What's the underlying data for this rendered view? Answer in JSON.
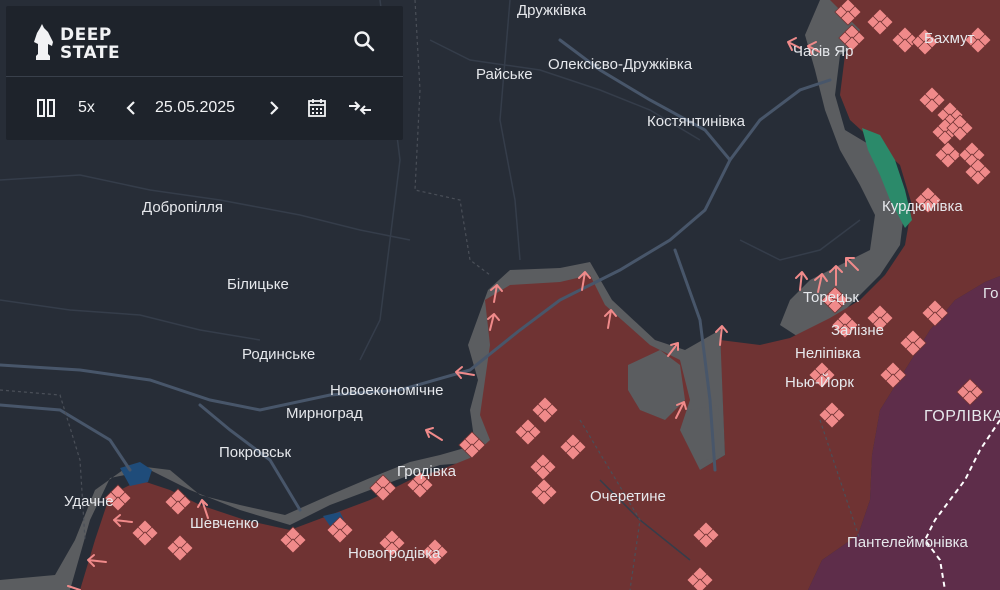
{
  "logo": {
    "line1": "DEEP",
    "line2": "STATE"
  },
  "toolbar": {
    "speed": "5x",
    "date": "25.05.2025"
  },
  "icons": {
    "logo": "horse-knight-icon",
    "search": "search-icon",
    "pause": "pause-icon",
    "prev": "chevron-left-icon",
    "next": "chevron-right-icon",
    "calendar": "calendar-icon",
    "compare": "compare-arrows-icon"
  },
  "colors": {
    "map_background": "#272d37",
    "occupied": "#6f3333",
    "contested": "#5b5d60",
    "liberated": "#2b8a6a",
    "occupied_before_2022": "#5e2d4a",
    "marker": "#f08a8a"
  },
  "places": [
    {
      "name": "Дружківка"
    },
    {
      "name": "Райське"
    },
    {
      "name": "Олексієво-Дружківка"
    },
    {
      "name": "Костянтинівка"
    },
    {
      "name": "Часів Яр"
    },
    {
      "name": "Бахмут"
    },
    {
      "name": "Курдюмівка"
    },
    {
      "name": "Торецьк"
    },
    {
      "name": "Залізне"
    },
    {
      "name": "Неліпівка"
    },
    {
      "name": "Нью-Йорк"
    },
    {
      "name": "ГОРЛІВКА"
    },
    {
      "name": "Добропілля"
    },
    {
      "name": "Білицьке"
    },
    {
      "name": "Родинське"
    },
    {
      "name": "Новоекономічне"
    },
    {
      "name": "Мирноград"
    },
    {
      "name": "Покровськ"
    },
    {
      "name": "Удачне"
    },
    {
      "name": "Шевченко"
    },
    {
      "name": "Гродівка"
    },
    {
      "name": "Очеретине"
    },
    {
      "name": "Новогродівка"
    },
    {
      "name": "Пантелеймонівка"
    },
    {
      "name": "Го"
    }
  ]
}
